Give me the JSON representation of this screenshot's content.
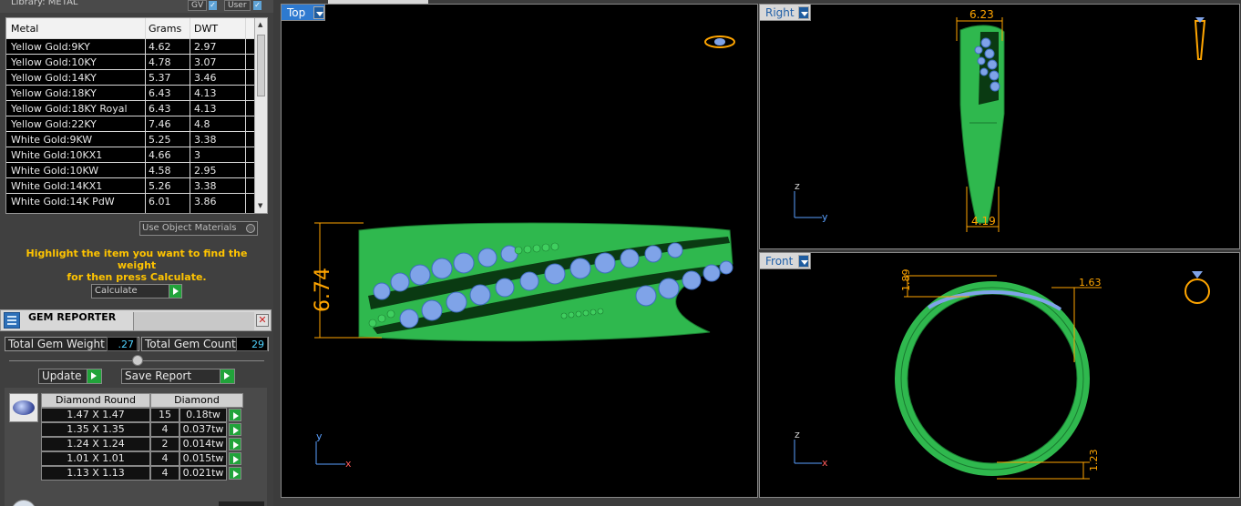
{
  "library": {
    "title": "Library: METAL",
    "gv_label": "GV",
    "user_label": "User",
    "check_glyph": "✓"
  },
  "metal_table": {
    "headers": [
      "Metal",
      "Grams",
      "DWT"
    ],
    "rows": [
      {
        "metal": "Yellow Gold:9KY",
        "grams": "4.62",
        "dwt": "2.97"
      },
      {
        "metal": "Yellow Gold:10KY",
        "grams": "4.78",
        "dwt": "3.07"
      },
      {
        "metal": "Yellow Gold:14KY",
        "grams": "5.37",
        "dwt": "3.46"
      },
      {
        "metal": "Yellow Gold:18KY",
        "grams": "6.43",
        "dwt": "4.13"
      },
      {
        "metal": "Yellow Gold:18KY Royal",
        "grams": "6.43",
        "dwt": "4.13"
      },
      {
        "metal": "Yellow Gold:22KY",
        "grams": "7.46",
        "dwt": "4.8"
      },
      {
        "metal": "White Gold:9KW",
        "grams": "5.25",
        "dwt": "3.38"
      },
      {
        "metal": "White Gold:10KX1",
        "grams": "4.66",
        "dwt": "3"
      },
      {
        "metal": "White Gold:10KW",
        "grams": "4.58",
        "dwt": "2.95"
      },
      {
        "metal": "White Gold:14KX1",
        "grams": "5.26",
        "dwt": "3.38"
      },
      {
        "metal": "White Gold:14K PdW",
        "grams": "6.01",
        "dwt": "3.86"
      }
    ]
  },
  "use_object_materials": "Use Object Materials",
  "hint_line1": "Highlight the item you want to find the weight",
  "hint_line2": "for then press Calculate.",
  "calculate_label": "Calculate",
  "gem_reporter": {
    "title": "GEM REPORTER",
    "close_glyph": "✕",
    "total_weight_label": "Total Gem Weight",
    "total_weight_value": ".27",
    "total_count_label": "Total Gem Count",
    "total_count_value": "29",
    "update_label": "Update",
    "save_report_label": "Save Report",
    "col_shape": "Diamond Round",
    "col_type": "Diamond",
    "rows": [
      {
        "size": "1.47 X 1.47",
        "count": "15",
        "weight": "0.18tw"
      },
      {
        "size": "1.35 X 1.35",
        "count": "4",
        "weight": "0.037tw"
      },
      {
        "size": "1.24 X 1.24",
        "count": "2",
        "weight": "0.014tw"
      },
      {
        "size": "1.01 X 1.01",
        "count": "4",
        "weight": "0.015tw"
      },
      {
        "size": "1.13 X 1.13",
        "count": "4",
        "weight": "0.021tw"
      }
    ]
  },
  "viewports": {
    "top": {
      "label": "Top",
      "dimension": "6.74",
      "axis_y": "y",
      "axis_x": "x"
    },
    "right": {
      "label": "Right",
      "dim_top": "6.23",
      "dim_bottom": "4.19",
      "axis_z": "z",
      "axis_y": "y"
    },
    "front": {
      "label": "Front",
      "dim_left": "1.89",
      "dim_right": "1.63",
      "dim_bottom": "1.23",
      "axis_z": "z",
      "axis_x": "x"
    }
  },
  "colors": {
    "ring_green": "#2fb84e",
    "gem_blue": "#7fa3e8",
    "dimension_orange": "#ffa500",
    "hint_yellow": "#ffc400"
  }
}
